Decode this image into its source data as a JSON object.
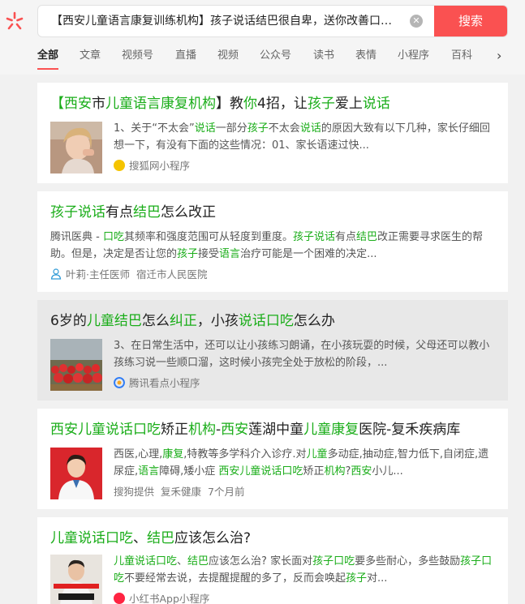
{
  "search": {
    "query": "【西安儿童语言康复训练机构】孩子说话结巴很自卑，送你改善口吃...",
    "button_label": "搜索"
  },
  "tabs": [
    "全部",
    "文章",
    "视频号",
    "直播",
    "视频",
    "公众号",
    "读书",
    "表情",
    "小程序",
    "百科"
  ],
  "results": [
    {
      "title": [
        [
          "【西安",
          true
        ],
        [
          "市",
          false
        ],
        [
          "儿童语言康复机构",
          true
        ],
        [
          "】教",
          false
        ],
        [
          "你",
          true
        ],
        [
          "4招，让",
          false
        ],
        [
          "孩子",
          true
        ],
        [
          "爱上",
          false
        ],
        [
          "说话",
          true
        ]
      ],
      "snippet": [
        [
          "1、关于“不太会”",
          false
        ],
        [
          "说话",
          true
        ],
        [
          "一部分",
          false
        ],
        [
          "孩子",
          true
        ],
        [
          "不太会",
          false
        ],
        [
          "说话",
          true
        ],
        [
          "的原因大致有以下几种，家长仔细回想一下，有没有下面的这些情况：01、家长语速过快...",
          false
        ]
      ],
      "source": "搜狐网小程序",
      "source_color": "#f5c400"
    },
    {
      "title": [
        [
          "孩子说话",
          true
        ],
        [
          "有点",
          false
        ],
        [
          "结巴",
          true
        ],
        [
          "怎么改正",
          false
        ]
      ],
      "snippet": [
        [
          "腾讯医典 - ",
          false
        ],
        [
          "口吃",
          true
        ],
        [
          "其频率和强度范围可从轻度到重度。",
          false
        ],
        [
          "孩子说话",
          true
        ],
        [
          "有点",
          false
        ],
        [
          "结巴",
          true
        ],
        [
          "改正需要寻求医生的帮助。但是，决定是否让您的",
          false
        ],
        [
          "孩子",
          true
        ],
        [
          "接受",
          false
        ],
        [
          "语言",
          true
        ],
        [
          "治疗可能是一个困难的决定...",
          false
        ]
      ],
      "doctor": "叶莉·主任医师",
      "hospital": "宿迁市人民医院"
    },
    {
      "title": [
        [
          "6岁的",
          false
        ],
        [
          "儿童结巴",
          true
        ],
        [
          "怎么",
          false
        ],
        [
          "纠正",
          true
        ],
        [
          "，小孩",
          false
        ],
        [
          "说话口吃",
          true
        ],
        [
          "怎么办",
          false
        ]
      ],
      "snippet": [
        [
          "3、在日常生活中，还可以让小孩练习朗诵，在小孩玩耍的时候，父母还可以教小孩练习说一些顺口溜，这时候小孩完全处于放松的阶段，...",
          false
        ]
      ],
      "source": "腾讯看点小程序",
      "source_color": "#2f7cf6"
    },
    {
      "title": [
        [
          "西安儿童说话口吃",
          true
        ],
        [
          "矫正",
          false
        ],
        [
          "机构",
          true
        ],
        [
          "-",
          false
        ],
        [
          "西安",
          true
        ],
        [
          "莲湖中童",
          false
        ],
        [
          "儿童康复",
          true
        ],
        [
          "医院-复禾疾病库",
          false
        ]
      ],
      "snippet": [
        [
          "西医,心理,",
          false
        ],
        [
          "康复",
          true
        ],
        [
          ",特教等多学科介入诊疗.对",
          false
        ],
        [
          "儿童",
          true
        ],
        [
          "多动症,抽动症,智力低下,自闭症,遗尿症,",
          false
        ],
        [
          "语言",
          true
        ],
        [
          "障碍,矮小症 ",
          false
        ],
        [
          "西安儿童说话口吃",
          true
        ],
        [
          "矫正",
          false
        ],
        [
          "机构",
          true
        ],
        [
          "?",
          false
        ],
        [
          "西安",
          true
        ],
        [
          "小儿...",
          false
        ]
      ],
      "provider": "搜狗提供",
      "site": "复禾健康",
      "time": "7个月前"
    },
    {
      "title": [
        [
          "儿童说话口吃",
          true
        ],
        [
          "、",
          false
        ],
        [
          "结巴",
          true
        ],
        [
          "应该怎么治?",
          false
        ]
      ],
      "snippet": [
        [
          "儿童说话口吃",
          true
        ],
        [
          "、",
          false
        ],
        [
          "结巴",
          true
        ],
        [
          "应该怎么治? 家长面对",
          false
        ],
        [
          "孩子口吃",
          true
        ],
        [
          "要多些耐心，多些鼓励",
          false
        ],
        [
          "孩子口吃",
          true
        ],
        [
          "不要经常去说，去提醒提醒的多了，反而会唤起",
          false
        ],
        [
          "孩子",
          true
        ],
        [
          "对...",
          false
        ]
      ],
      "source": "小红书App小程序",
      "source_color": "#ff2442"
    }
  ]
}
